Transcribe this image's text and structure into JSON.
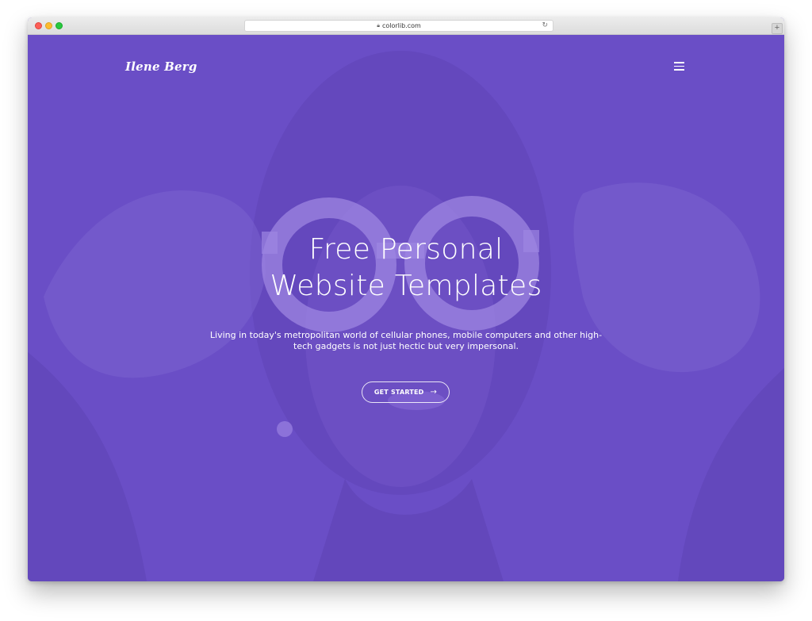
{
  "browser": {
    "url": "colorlib.com",
    "lock_icon": "lock-icon",
    "reload_icon": "reload-icon",
    "new_tab_label": "+"
  },
  "site": {
    "logo": "Ilene Berg",
    "menu_icon": "hamburger-menu-icon"
  },
  "hero": {
    "headline_line1": "Free Personal",
    "headline_line2": "Website Templates",
    "subtext": "Living in today's metropolitan world of cellular phones, mobile computers and other high-tech gadgets is not just hectic but very impersonal.",
    "cta_label": "GET STARTED",
    "cta_arrow": "→"
  },
  "colors": {
    "overlay": "#6a4ec6",
    "text": "#ffffff"
  }
}
